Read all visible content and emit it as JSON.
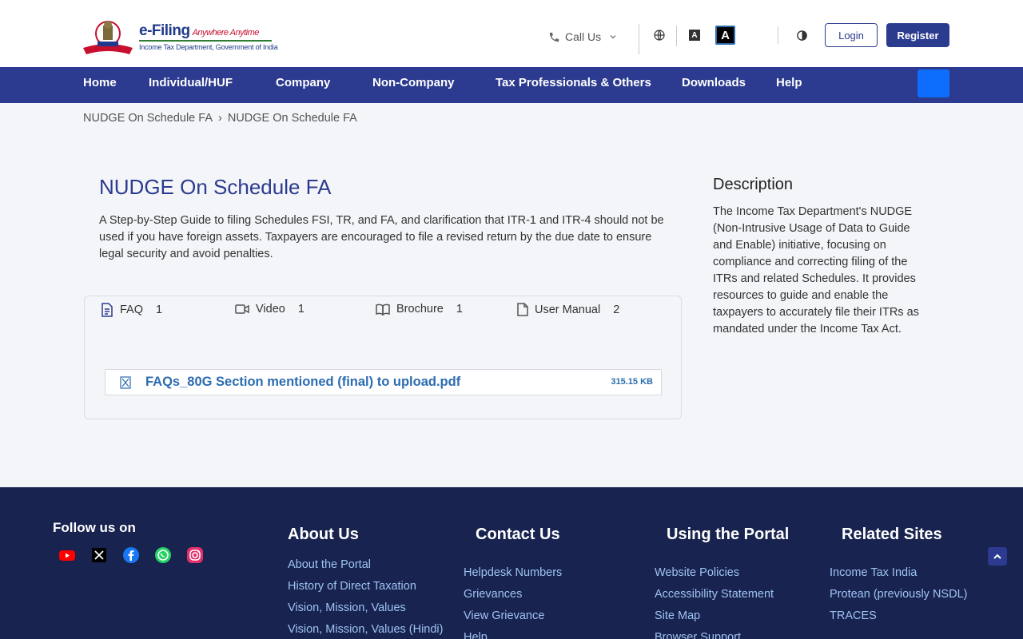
{
  "header": {
    "logo_title": "e-Filing",
    "logo_tagline": "Anywhere Anytime",
    "logo_dept": "Income Tax Department, Government of India",
    "call_us": "Call Us",
    "font_small": "A",
    "font_large": "A",
    "login": "Login",
    "register": "Register"
  },
  "nav": {
    "items": [
      "Home",
      "Individual/HUF",
      "Company",
      "Non-Company",
      "Tax Professionals & Others",
      "Downloads",
      "Help"
    ]
  },
  "breadcrumb": [
    "NUDGE On Schedule FA",
    "NUDGE On Schedule FA"
  ],
  "breadcrumb_separator": "›",
  "main": {
    "title": "NUDGE On Schedule FA",
    "description": "A Step-by-Step Guide to filing Schedules FSI, TR, and FA, and clarification that ITR-1 and ITR-4 should not be used if you have foreign assets. Taxpayers are encouraged to file a revised return by the due date to ensure legal security and avoid penalties.",
    "tabs": [
      {
        "label": "FAQ",
        "count": "1"
      },
      {
        "label": "Video",
        "count": "1"
      },
      {
        "label": "Brochure",
        "count": "1"
      },
      {
        "label": "User Manual",
        "count": "2"
      }
    ],
    "file": {
      "name": "FAQs_80G Section mentioned (final) to upload.pdf",
      "size": "315.15 KB"
    }
  },
  "sidebar": {
    "title": "Description",
    "text": "The Income Tax Department's NUDGE (Non-Intrusive Usage of Data to Guide and Enable) initiative, focusing on compliance and correcting filing of the ITRs and related Schedules. It provides resources to guide and enable the taxpayers to accurately file their ITRs as mandated under the Income Tax Act."
  },
  "footer": {
    "follow": "Follow us on",
    "social": [
      "youtube-icon",
      "x-icon",
      "facebook-icon",
      "whatsapp-icon",
      "instagram-icon"
    ],
    "columns": [
      {
        "title": "About Us",
        "links": [
          "About the Portal",
          "History of Direct Taxation",
          "Vision, Mission, Values",
          "Vision, Mission, Values (Hindi)"
        ]
      },
      {
        "title": "Contact Us",
        "links": [
          "Helpdesk Numbers",
          "Grievances",
          "View Grievance",
          "Help"
        ]
      },
      {
        "title": "Using the Portal",
        "links": [
          "Website Policies",
          "Accessibility Statement",
          "Site Map",
          "Browser Support"
        ]
      },
      {
        "title": "Related Sites",
        "links": [
          "Income Tax India",
          "Protean (previously NSDL)",
          "TRACES"
        ]
      }
    ]
  },
  "colors": {
    "primary": "#2c3b8f",
    "footer_bg": "#18234f",
    "link": "#2b6cb0",
    "footer_link": "#9fc3f3"
  }
}
